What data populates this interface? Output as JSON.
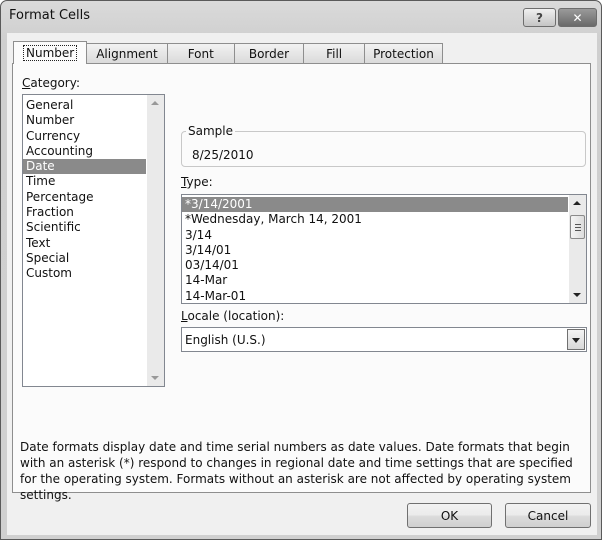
{
  "window": {
    "title": "Format Cells",
    "help_label": "?",
    "close_label": "✕"
  },
  "tabs": [
    {
      "label": "Number",
      "active": true
    },
    {
      "label": "Alignment"
    },
    {
      "label": "Font"
    },
    {
      "label": "Border"
    },
    {
      "label": "Fill"
    },
    {
      "label": "Protection"
    }
  ],
  "category": {
    "label_mnemonic": "C",
    "label_rest": "ategory:",
    "items": [
      "General",
      "Number",
      "Currency",
      "Accounting",
      "Date",
      "Time",
      "Percentage",
      "Fraction",
      "Scientific",
      "Text",
      "Special",
      "Custom"
    ],
    "selected": "Date"
  },
  "sample": {
    "legend": "Sample",
    "value": "8/25/2010"
  },
  "type": {
    "label_mnemonic": "T",
    "label_rest": "ype:",
    "items": [
      "*3/14/2001",
      "*Wednesday, March 14, 2001",
      "3/14",
      "3/14/01",
      "03/14/01",
      "14-Mar",
      "14-Mar-01"
    ],
    "selected": "*3/14/2001"
  },
  "locale": {
    "label_mnemonic": "L",
    "label_rest": "ocale (location):",
    "value": "English (U.S.)"
  },
  "description": "Date formats display date and time serial numbers as date values.  Date formats that begin with an asterisk (*) respond to changes in regional date and time settings that are specified for the operating system. Formats without an asterisk are not affected by operating system settings.",
  "buttons": {
    "ok": "OK",
    "cancel": "Cancel"
  }
}
